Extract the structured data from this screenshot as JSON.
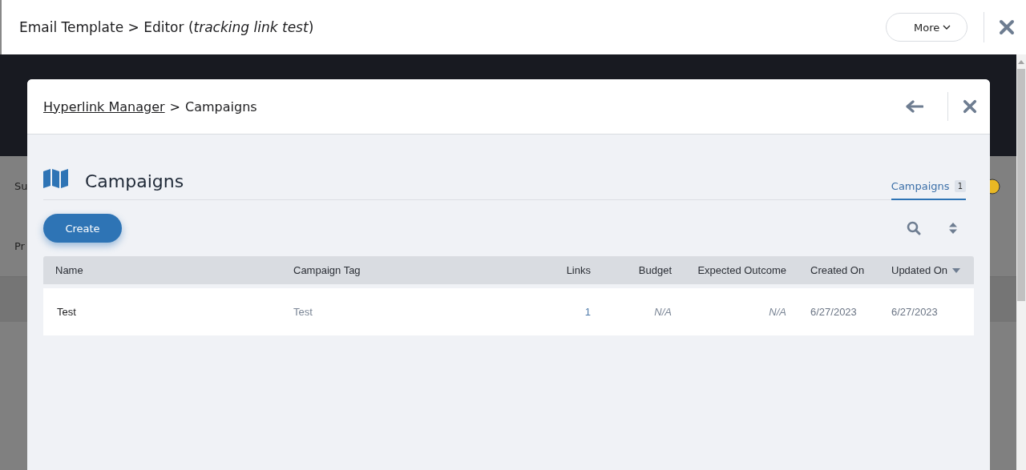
{
  "window": {
    "title": "Email Template > Editor (*tracking link test*)",
    "more_button": "More"
  },
  "background_labels": [
    "Su",
    "Pr"
  ],
  "modal": {
    "breadcrumb": {
      "link": "Hyperlink Manager",
      "separator": ">",
      "current": "Campaigns"
    },
    "section_title": "Campaigns",
    "tabs": [
      {
        "label": "Campaigns",
        "count": "1",
        "selected": true
      }
    ],
    "create_button": "Create",
    "table": {
      "columns": [
        {
          "label": "Name",
          "sorted": false
        },
        {
          "label": "Campaign Tag",
          "sorted": false
        },
        {
          "label": "Links",
          "sorted": false
        },
        {
          "label": "Budget",
          "sorted": false
        },
        {
          "label": "Expected Outcome",
          "sorted": false
        },
        {
          "label": "Created On",
          "sorted": false
        },
        {
          "label": "Updated On",
          "sorted": true
        }
      ],
      "rows": [
        {
          "cells": [
            "Test",
            "Test",
            "1",
            "N/A",
            "N/A",
            "6/27/2023",
            "6/27/2023"
          ]
        }
      ]
    }
  }
}
